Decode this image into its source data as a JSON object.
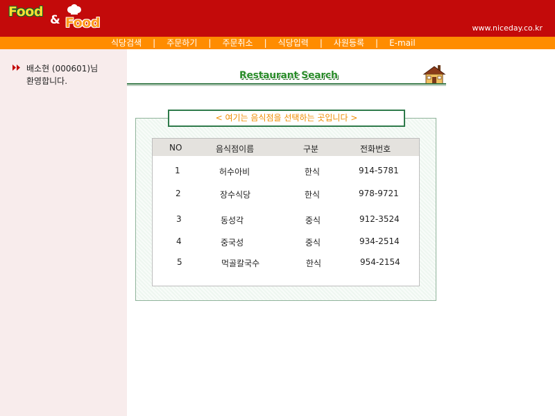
{
  "header": {
    "logo_word1": "Food",
    "logo_amp": "&",
    "logo_word2": "Food",
    "site_url": "www.niceday.co.kr"
  },
  "nav": {
    "items": [
      "식당검색",
      "주문하기",
      "주문취소",
      "식당입력",
      "사원등록",
      "E-mail"
    ],
    "separator": "|"
  },
  "sidebar": {
    "welcome_line1": "배소현 (000601)님",
    "welcome_line2": "환영합니다."
  },
  "main": {
    "title": "Restaurant Search",
    "caption": "< 여기는 음식점을 선택하는 곳입니다 >",
    "table": {
      "headers": [
        "NO",
        "음식점이름",
        "구분",
        "전화번호"
      ],
      "rows": [
        [
          "1",
          "허수아비",
          "한식",
          "914-5781"
        ],
        [
          "2",
          "장수식당",
          "한식",
          "978-9721"
        ],
        [
          "3",
          "동성각",
          "중식",
          "912-3524"
        ],
        [
          "4",
          "중국성",
          "중식",
          "934-2514"
        ],
        [
          "5",
          "먹골칼국수",
          "한식",
          "954-2154"
        ]
      ]
    }
  },
  "colors": {
    "header_red": "#c30a0a",
    "nav_orange": "#ff8c00",
    "sidebar_pink": "#f8ecec",
    "title_green": "#2a8c2a",
    "caption_orange": "#f08c00"
  },
  "icons": {
    "logo": "chef-hat-icon",
    "welcome_bullet": "double-arrow-icon",
    "title_decoration": "house-icon"
  }
}
